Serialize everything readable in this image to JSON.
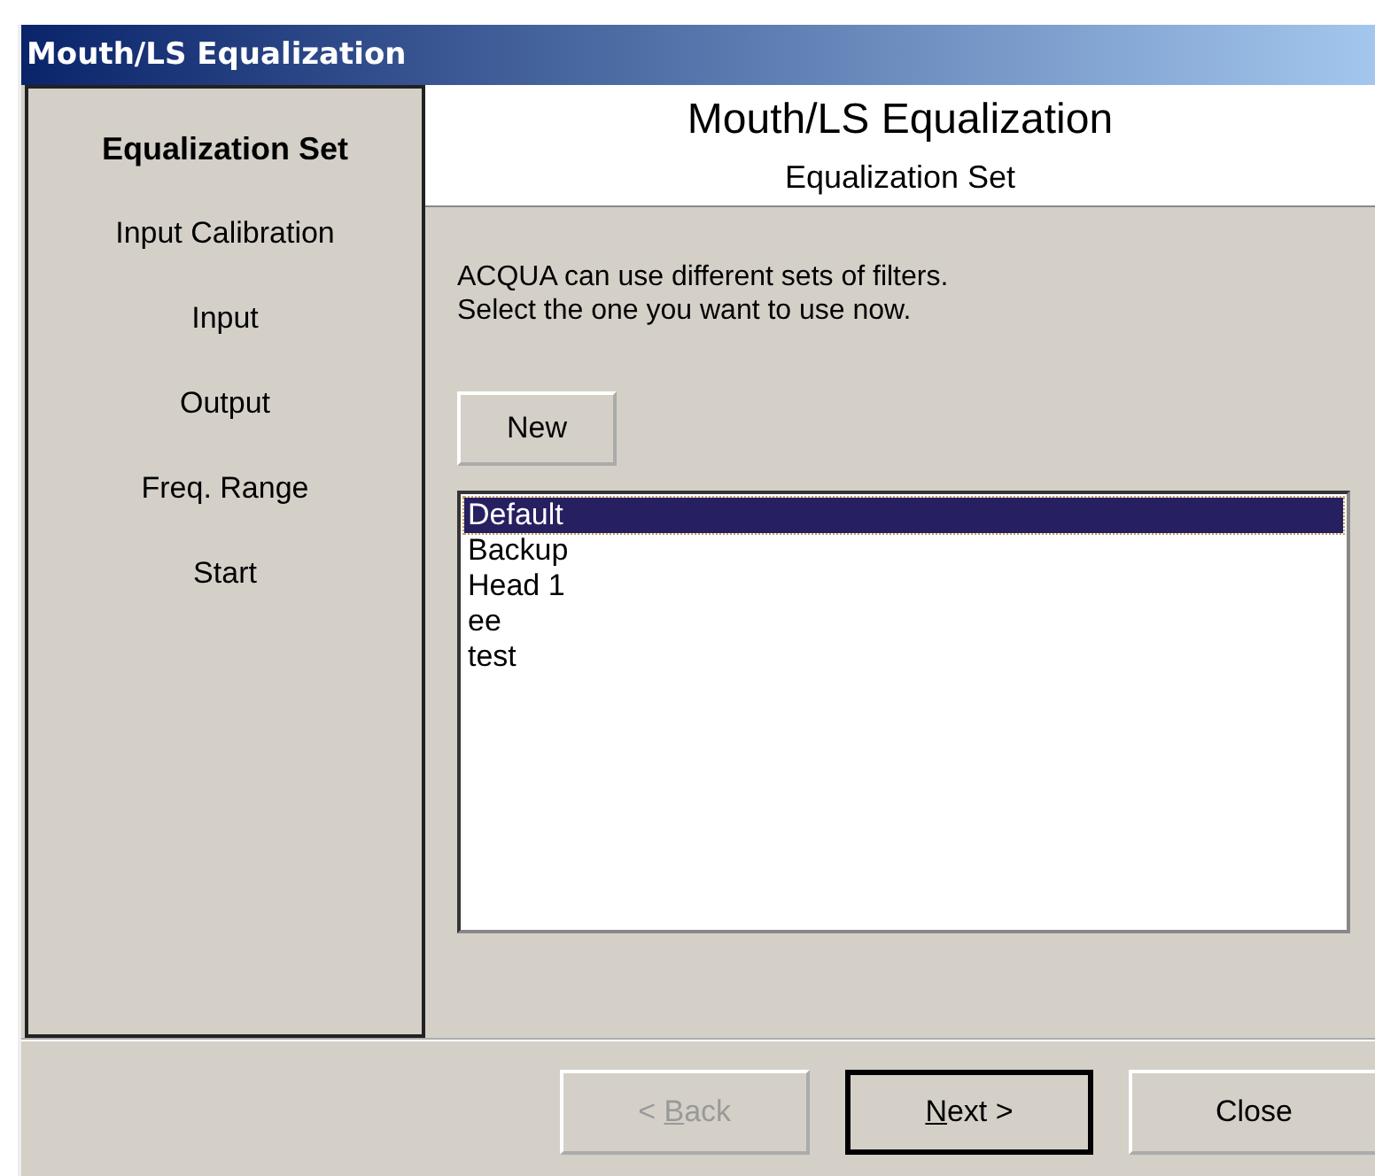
{
  "window": {
    "title": "Mouth/LS Equalization"
  },
  "steps": [
    {
      "label": "Equalization Set",
      "selected": true
    },
    {
      "label": "Input Calibration",
      "selected": false
    },
    {
      "label": "Input",
      "selected": false
    },
    {
      "label": "Output",
      "selected": false
    },
    {
      "label": "Freq. Range",
      "selected": false
    },
    {
      "label": "Start",
      "selected": false
    }
  ],
  "header": {
    "title": "Mouth/LS Equalization",
    "subtitle": "Equalization Set"
  },
  "description": [
    "ACQUA can use different sets of filters.",
    "Select the one you want to use now."
  ],
  "new_button": {
    "label": "New"
  },
  "filter_sets": [
    {
      "label": "Default",
      "selected": true
    },
    {
      "label": "Backup",
      "selected": false
    },
    {
      "label": "Head 1",
      "selected": false
    },
    {
      "label": "ee",
      "selected": false
    },
    {
      "label": "test",
      "selected": false
    }
  ],
  "buttons": [
    {
      "before": "< ",
      "mnemonic": "B",
      "after": "ack",
      "disabled": true,
      "default": false
    },
    {
      "mnemonic": "N",
      "after": "ext >",
      "disabled": false,
      "default": true
    },
    {
      "before": "Close",
      "disabled": false,
      "default": false
    }
  ]
}
